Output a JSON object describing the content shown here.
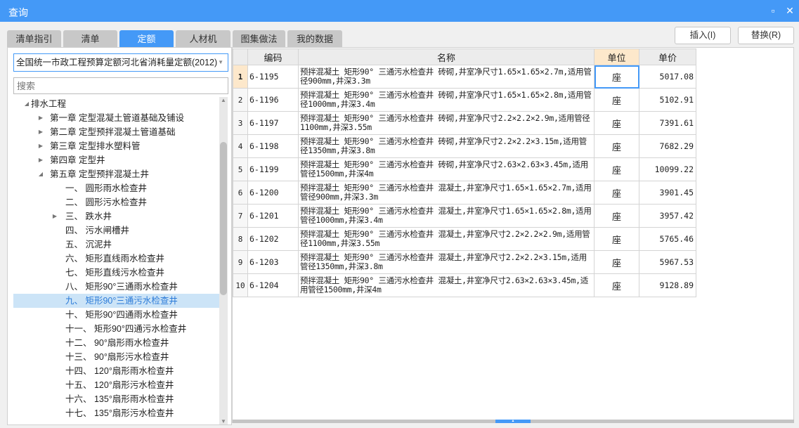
{
  "window": {
    "title": "查询"
  },
  "tabs": [
    {
      "label": "清单指引"
    },
    {
      "label": "清单"
    },
    {
      "label": "定额",
      "active": true
    },
    {
      "label": "人材机"
    },
    {
      "label": "图集做法"
    },
    {
      "label": "我的数据"
    }
  ],
  "left": {
    "library": "全国统一市政工程预算定额河北省消耗量定额(2012)",
    "search_placeholder": "搜索",
    "tree": [
      {
        "label": "排水工程",
        "level": 0,
        "toggle": "expanded"
      },
      {
        "label": "第一章 定型混凝土管道基础及铺设",
        "level": 1,
        "toggle": "collapsed"
      },
      {
        "label": "第二章 定型预拌混凝土管道基础",
        "level": 1,
        "toggle": "collapsed"
      },
      {
        "label": "第三章 定型排水塑料管",
        "level": 1,
        "toggle": "collapsed"
      },
      {
        "label": "第四章 定型井",
        "level": 1,
        "toggle": "collapsed"
      },
      {
        "label": "第五章 定型预拌混凝土井",
        "level": 1,
        "toggle": "expanded"
      },
      {
        "label": "一、  圆形雨水检查井",
        "level": 2,
        "toggle": ""
      },
      {
        "label": "二、  圆形污水检查井",
        "level": 2,
        "toggle": ""
      },
      {
        "label": "三、  跌水井",
        "level": 2,
        "toggle": "collapsed"
      },
      {
        "label": "四、  污水闸槽井",
        "level": 2,
        "toggle": ""
      },
      {
        "label": "五、  沉泥井",
        "level": 2,
        "toggle": ""
      },
      {
        "label": "六、  矩形直线雨水检查井",
        "level": 2,
        "toggle": ""
      },
      {
        "label": "七、  矩形直线污水检查井",
        "level": 2,
        "toggle": ""
      },
      {
        "label": "八、  矩形90°三通雨水检查井",
        "level": 2,
        "toggle": ""
      },
      {
        "label": "九、  矩形90°三通污水检查井",
        "level": 2,
        "toggle": "",
        "selected": true
      },
      {
        "label": "十、  矩形90°四通雨水检查井",
        "level": 2,
        "toggle": ""
      },
      {
        "label": "十一、  矩形90°四通污水检查井",
        "level": 2,
        "toggle": ""
      },
      {
        "label": "十二、  90°扇形雨水检查井",
        "level": 2,
        "toggle": ""
      },
      {
        "label": "十三、  90°扇形污水检查井",
        "level": 2,
        "toggle": ""
      },
      {
        "label": "十四、  120°扇形雨水检查井",
        "level": 2,
        "toggle": ""
      },
      {
        "label": "十五、  120°扇形污水检查井",
        "level": 2,
        "toggle": ""
      },
      {
        "label": "十六、  135°扇形雨水检查井",
        "level": 2,
        "toggle": ""
      },
      {
        "label": "十七、  135°扇形污水检查井",
        "level": 2,
        "toggle": ""
      }
    ]
  },
  "toolbar": {
    "insert_label": "插入(I)",
    "replace_label": "替换(R)"
  },
  "grid": {
    "headers": {
      "code": "编码",
      "name": "名称",
      "unit": "单位",
      "price": "单价"
    },
    "rows": [
      {
        "n": "1",
        "code": "6-1195",
        "name": "预拌混凝土 矩形90° 三通污水检查井 砖砌,井室净尺寸1.65×1.65×2.7m,适用管径900mm,井深3.3m",
        "unit": "座",
        "price": "5017.08"
      },
      {
        "n": "2",
        "code": "6-1196",
        "name": "预拌混凝土 矩形90° 三通污水检查井 砖砌,井室净尺寸1.65×1.65×2.8m,适用管径1000mm,井深3.4m",
        "unit": "座",
        "price": "5102.91"
      },
      {
        "n": "3",
        "code": "6-1197",
        "name": "预拌混凝土 矩形90° 三通污水检查井 砖砌,井室净尺寸2.2×2.2×2.9m,适用管径1100mm,井深3.55m",
        "unit": "座",
        "price": "7391.61"
      },
      {
        "n": "4",
        "code": "6-1198",
        "name": "预拌混凝土 矩形90° 三通污水检查井 砖砌,井室净尺寸2.2×2.2×3.15m,适用管径1350mm,井深3.8m",
        "unit": "座",
        "price": "7682.29"
      },
      {
        "n": "5",
        "code": "6-1199",
        "name": "预拌混凝土 矩形90° 三通污水检查井 砖砌,井室净尺寸2.63×2.63×3.45m,适用管径1500mm,井深4m",
        "unit": "座",
        "price": "10099.22"
      },
      {
        "n": "6",
        "code": "6-1200",
        "name": "预拌混凝土 矩形90° 三通污水检查井 混凝土,井室净尺寸1.65×1.65×2.7m,适用管径900mm,井深3.3m",
        "unit": "座",
        "price": "3901.45"
      },
      {
        "n": "7",
        "code": "6-1201",
        "name": "预拌混凝土 矩形90° 三通污水检查井 混凝土,井室净尺寸1.65×1.65×2.8m,适用管径1000mm,井深3.4m",
        "unit": "座",
        "price": "3957.42"
      },
      {
        "n": "8",
        "code": "6-1202",
        "name": "预拌混凝土 矩形90° 三通污水检查井 混凝土,井室净尺寸2.2×2.2×2.9m,适用管径1100mm,井深3.55m",
        "unit": "座",
        "price": "5765.46"
      },
      {
        "n": "9",
        "code": "6-1203",
        "name": "预拌混凝土 矩形90° 三通污水检查井 混凝土,井室净尺寸2.2×2.2×3.15m,适用管径1350mm,井深3.8m",
        "unit": "座",
        "price": "5967.53"
      },
      {
        "n": "10",
        "code": "6-1204",
        "name": "预拌混凝土 矩形90° 三通污水检查井 混凝土,井室净尺寸2.63×2.63×3.45m,适用管径1500mm,井深4m",
        "unit": "座",
        "price": "9128.89"
      }
    ]
  }
}
